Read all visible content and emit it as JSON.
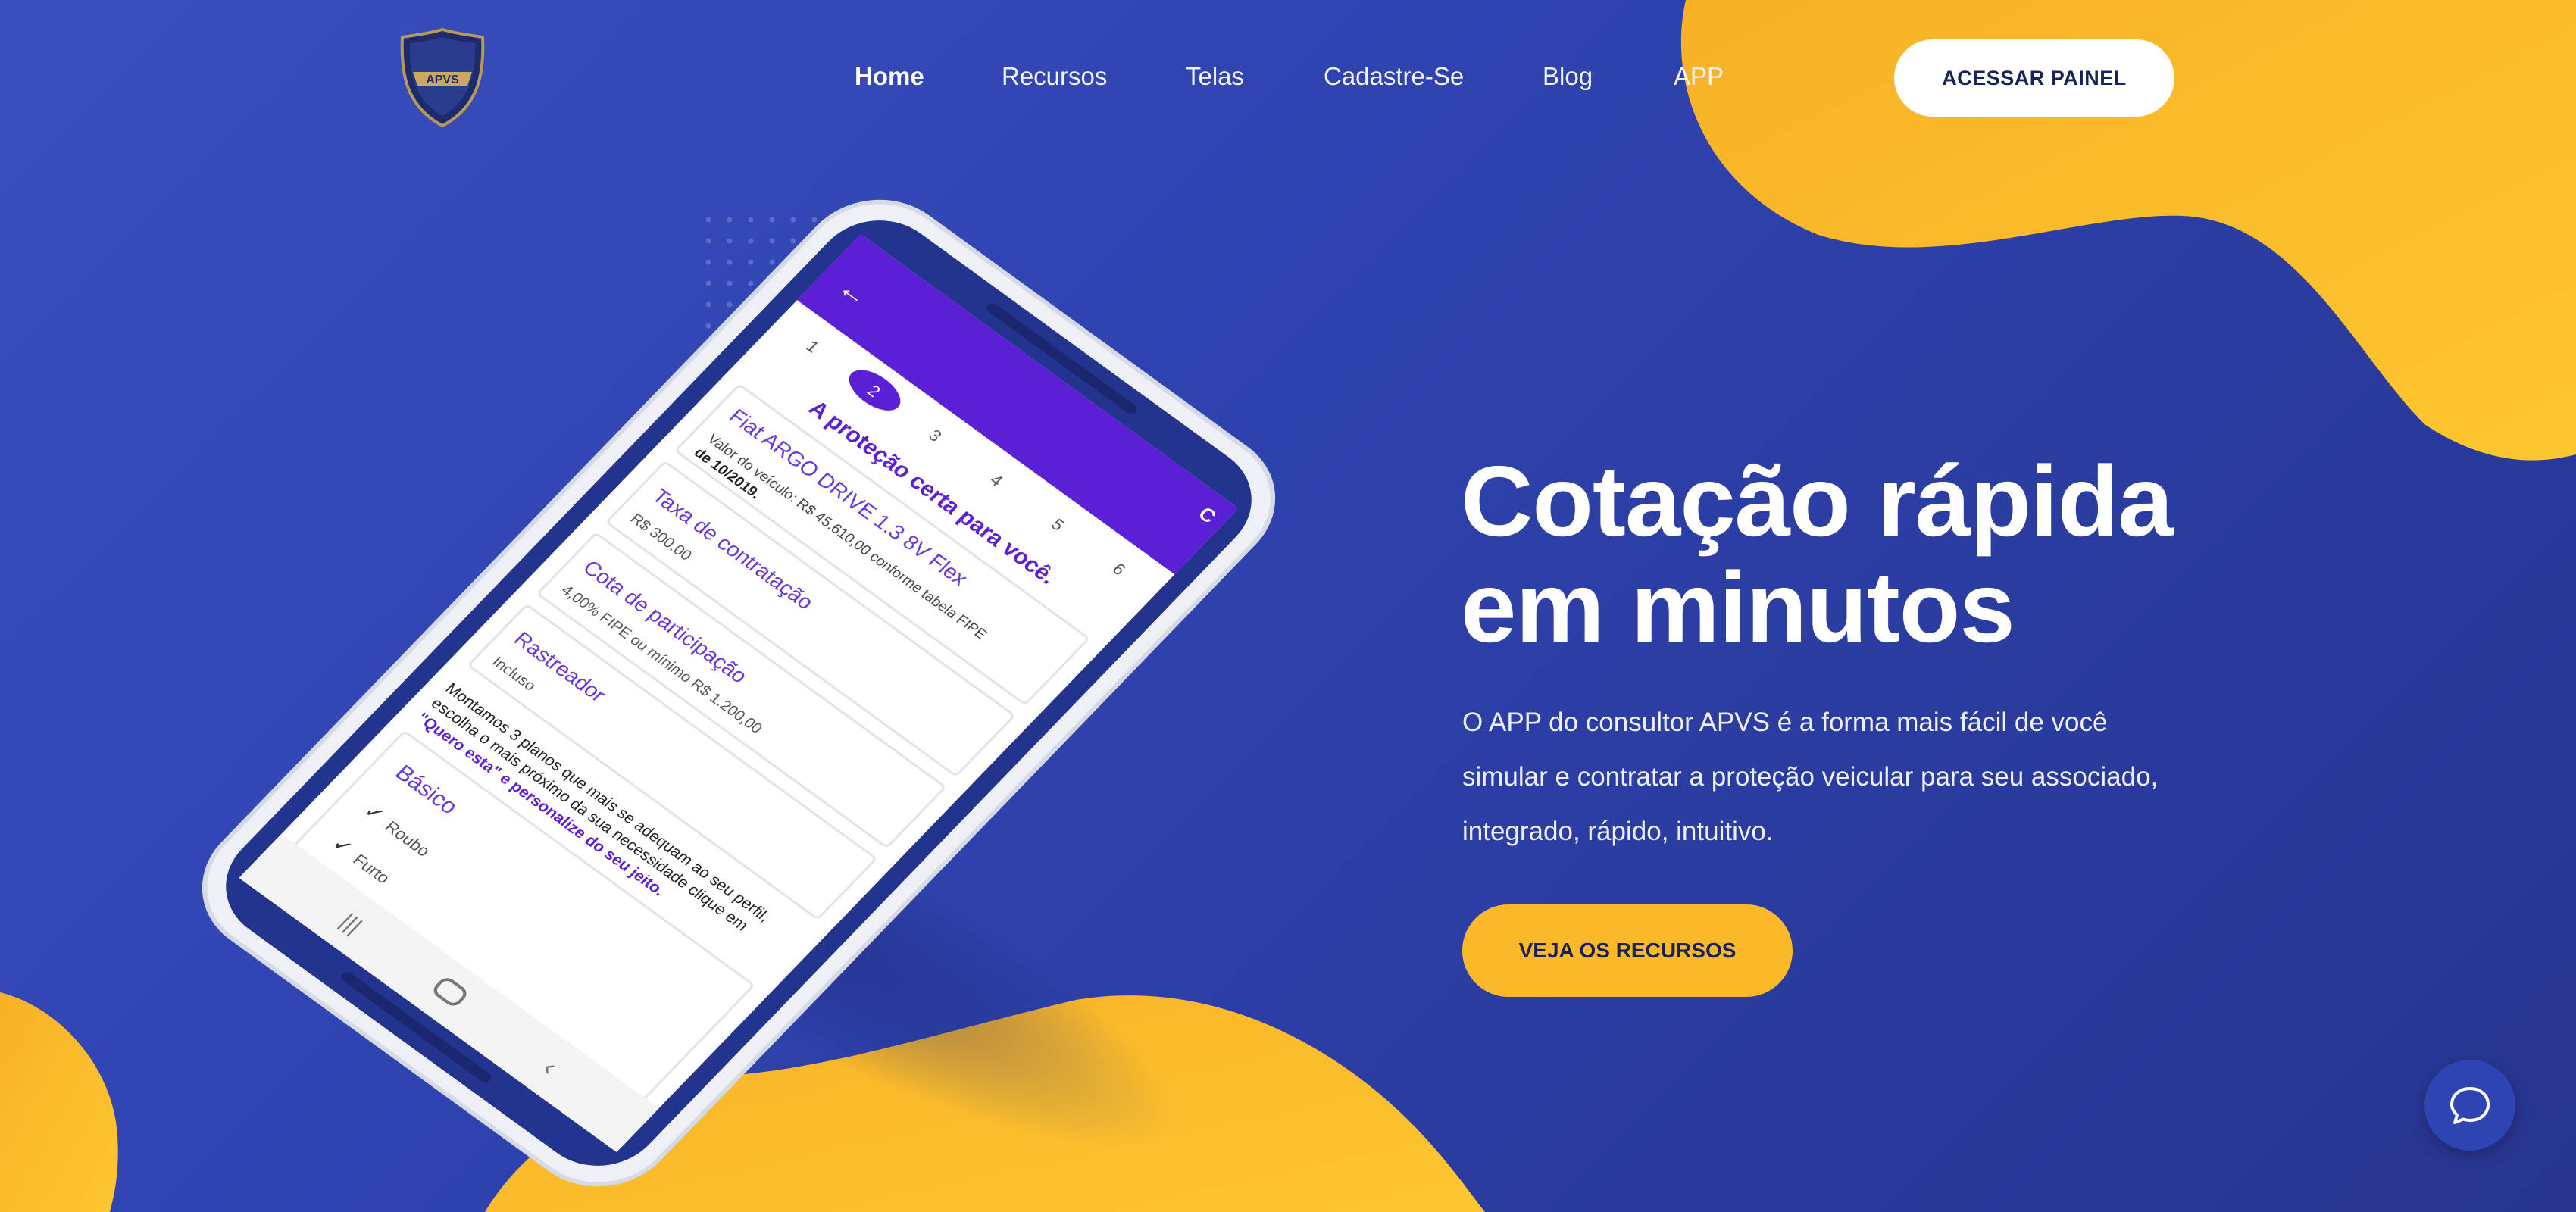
{
  "colors": {
    "background": "#2f43b0",
    "accent_yellow": "#fbb829",
    "app_purple": "#5b1fd6",
    "button_text_dark": "#17225a"
  },
  "logo": {
    "text": "APVS"
  },
  "nav": {
    "items": [
      {
        "label": "Home",
        "active": true
      },
      {
        "label": "Recursos"
      },
      {
        "label": "Telas"
      },
      {
        "label": "Cadastre-Se"
      },
      {
        "label": "Blog"
      },
      {
        "label": "APP"
      }
    ],
    "cta_label": "ACESSAR PAINEL"
  },
  "hero": {
    "title_line1": "Cotação rápida",
    "title_line2": "em minutos",
    "description": "O APP do consultor APVS é a forma mais fácil de você simular e contratar a proteção veicular para seu associado, integrado, rápido, intuitivo.",
    "cta_label": "VEJA OS RECURSOS"
  },
  "phone_screen": {
    "steps": [
      "1",
      "2",
      "3",
      "4",
      "5",
      "6"
    ],
    "active_step": "2",
    "header_letter": "C",
    "heading": "A proteção certa para você.",
    "vehicle_title": "Fiat ARGO DRIVE 1.3 8V Flex",
    "vehicle_value_line1": "Valor do veículo: R$ 45.610,00 conforme tabela FIPE",
    "vehicle_value_line2": "de 10/2019.",
    "fee_title": "Taxa de contratação",
    "fee_value": "R$ 300,00",
    "quota_title": "Cota de participação",
    "quota_value": "4,00% FIPE ou mínimo R$ 1.200,00",
    "tracker_title": "Rastreador",
    "tracker_value": "Incluso",
    "plans_text_line1": "Montamos 3 planos que mais se adequam ao seu perfil,",
    "plans_text_line2": "escolha o mais próximo da sua necessidade clique em",
    "plans_text_line3": "\"Quero esta\" e personalize do seu jeito.",
    "plan_name": "Básico",
    "coverage": [
      "Roubo",
      "Furto"
    ]
  }
}
